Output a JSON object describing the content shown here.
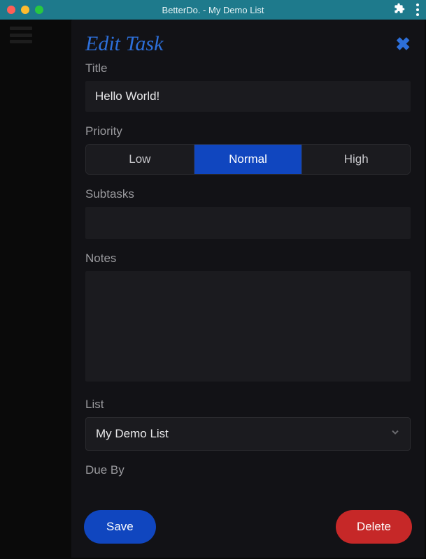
{
  "titlebar": {
    "title": "BetterDo. - My Demo List"
  },
  "modal": {
    "heading": "Edit Task",
    "labels": {
      "title": "Title",
      "priority": "Priority",
      "subtasks": "Subtasks",
      "notes": "Notes",
      "list": "List",
      "due_by": "Due By"
    },
    "title_value": "Hello World!",
    "priority_options": {
      "low": "Low",
      "normal": "Normal",
      "high": "High"
    },
    "priority_selected": "normal",
    "notes_value": "",
    "list_value": "My Demo List",
    "buttons": {
      "save": "Save",
      "delete": "Delete"
    }
  }
}
